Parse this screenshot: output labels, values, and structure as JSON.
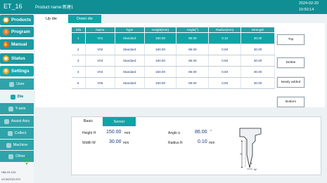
{
  "header": {
    "machine_id": "ET_16",
    "product_name": "Product name:新建1",
    "date": "2024-02-20",
    "time": "10:50:14"
  },
  "sidebar": {
    "items": [
      {
        "label": "Products",
        "icon": "products-icon"
      },
      {
        "label": "Program",
        "icon": "program-icon"
      },
      {
        "label": "Manual",
        "icon": "manual-icon"
      },
      {
        "label": "Status",
        "icon": "status-icon"
      },
      {
        "label": "Settings",
        "icon": "settings-icon"
      }
    ],
    "sub_items": [
      {
        "label": "User"
      },
      {
        "label": "Die"
      },
      {
        "label": "Y-axis"
      },
      {
        "label": "Assist Axis"
      },
      {
        "label": "Collect"
      },
      {
        "label": "Machine"
      },
      {
        "label": "Other"
      }
    ],
    "version_line1": "HM-V2.124",
    "version_line2": "V2.0027(S-974"
  },
  "tabs": {
    "up_die": "Up die",
    "down_die": "Down die"
  },
  "table": {
    "columns": [
      "S/N",
      "Name",
      "Type",
      "Height(mm)",
      "Angle(°)",
      "Radius(mm)",
      "Strength"
    ],
    "rows": [
      [
        "1",
        "V01",
        "Standard",
        "150.00",
        "86.00",
        "0.10",
        "30.00"
      ],
      [
        "2",
        "V02",
        "Standard",
        "150.00",
        "86.00",
        "0.50",
        "30.00"
      ],
      [
        "3",
        "V03",
        "Standard",
        "150.00",
        "86.00",
        "0.50",
        "30.00"
      ],
      [
        "4",
        "V04",
        "Standard",
        "150.00",
        "86.00",
        "0.50",
        "30.00"
      ],
      [
        "5",
        "V05",
        "Standard",
        "150.00",
        "86.00",
        "0.50",
        "30.00"
      ]
    ],
    "selected_row": 0
  },
  "actions": {
    "top": "Top",
    "delete": "Delete",
    "newly_added": "Newly added",
    "bottom": "Bottom"
  },
  "detail": {
    "tab_basic": "Basic",
    "tab_senior": "Senior",
    "height_label": "Height H",
    "height_value": "150.00",
    "height_unit": "mm",
    "width_label": "Width W",
    "width_value": "30.00",
    "width_unit": "mm",
    "angle_label": "Angle α",
    "angle_value": "86.00",
    "angle_unit": "°",
    "radius_label": "Radius R",
    "radius_value": "0.10",
    "radius_unit": "mm",
    "drawing_labels": {
      "h": "H",
      "w": "W",
      "a": "α"
    }
  },
  "colors": {
    "accent": "#13a2a6",
    "header": "#0f8f94"
  }
}
